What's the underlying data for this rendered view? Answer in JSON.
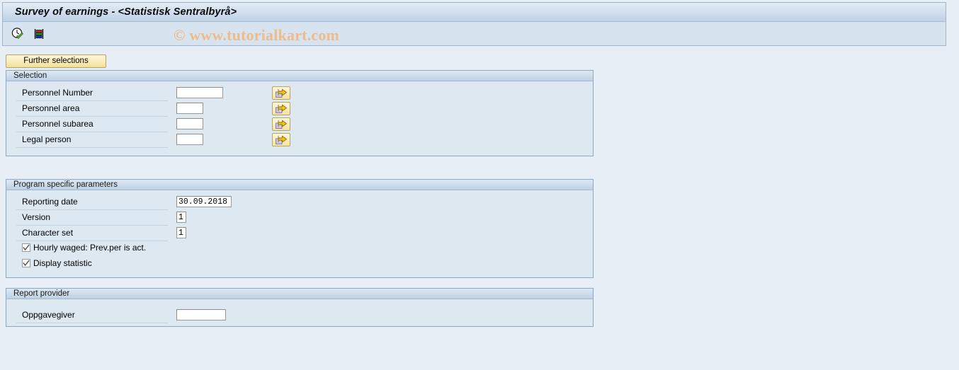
{
  "window": {
    "title": "Survey of earnings - <Statistisk Sentralbyrå>"
  },
  "toolbar": {
    "icons": [
      {
        "name": "execute-clock-check-icon",
        "title": "Execute"
      },
      {
        "name": "color-bars-list-icon",
        "title": "Display variants"
      }
    ],
    "watermark": "© www.tutorialkart.com"
  },
  "actions": {
    "further_selections_label": "Further selections"
  },
  "sections": {
    "selection": {
      "header": "Selection",
      "rows": [
        {
          "label": "Personnel Number",
          "value": "",
          "field_width": 66,
          "has_arrow": true,
          "arrow_icon": "multiple-selection-arrow-icon"
        },
        {
          "label": "Personnel area",
          "value": "",
          "field_width": 38,
          "has_arrow": true,
          "arrow_icon": "multiple-selection-arrow-icon"
        },
        {
          "label": "Personnel subarea",
          "value": "",
          "field_width": 38,
          "has_arrow": true,
          "arrow_icon": "multiple-selection-arrow-icon"
        },
        {
          "label": "Legal person",
          "value": "",
          "field_width": 38,
          "has_arrow": true,
          "arrow_icon": "multiple-selection-arrow-icon"
        }
      ]
    },
    "program_specific_parameters": {
      "header": "Program specific parameters",
      "rows": [
        {
          "label": "Reporting date",
          "value": "30.09.2018",
          "field_width": 78
        },
        {
          "label": "Version",
          "value": "1",
          "field_width": 13
        },
        {
          "label": "Character set",
          "value": "1",
          "field_width": 13
        }
      ],
      "checkboxes": [
        {
          "label": "Hourly waged: Prev.per is act.",
          "checked": true
        },
        {
          "label": "Display statistic",
          "checked": true
        }
      ]
    },
    "report_provider": {
      "header": "Report provider",
      "rows": [
        {
          "label": "Oppgavegiver",
          "value": "",
          "field_width": 70
        }
      ]
    }
  },
  "colors": {
    "page_background": "#e8eef5",
    "panel_background": "#dde8f0",
    "panel_border": "#8ba9c4",
    "titlebar_gradient_top": "#e4ecf5",
    "titlebar_gradient_bottom": "#bfd2e5",
    "button_yellow": "#f9edbe",
    "watermark_color": "#edbb8c",
    "arrow_yellow": "#f5c21a",
    "doc_lavender": "#d2c8e4"
  }
}
